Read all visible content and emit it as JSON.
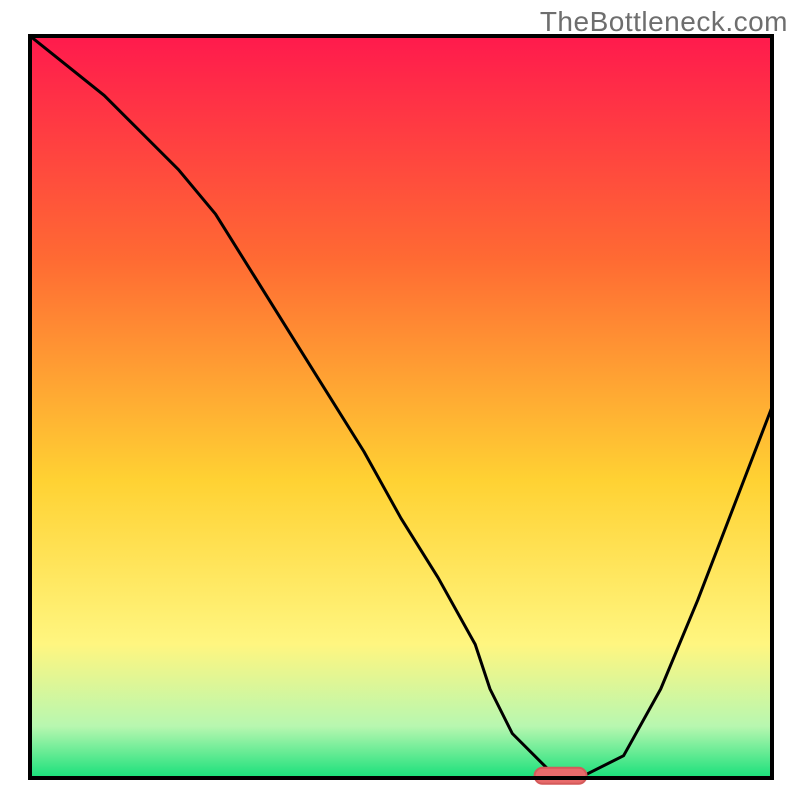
{
  "watermark": "TheBottleneck.com",
  "colors": {
    "gradient_top": "#ff1a4d",
    "gradient_mid1": "#ff6a33",
    "gradient_mid2": "#ffd233",
    "gradient_mid3": "#fff680",
    "gradient_bottom_soft": "#b8f7b0",
    "gradient_bottom": "#18e07a",
    "curve": "#000000",
    "frame": "#000000",
    "marker_fill": "#e86b6b",
    "marker_stroke": "#d45a5a"
  },
  "plot": {
    "inner_x": 30,
    "inner_y": 36,
    "inner_w": 742,
    "inner_h": 742
  },
  "chart_data": {
    "type": "line",
    "title": "",
    "xlabel": "",
    "ylabel": "",
    "xlim": [
      0,
      100
    ],
    "ylim": [
      0,
      100
    ],
    "grid": false,
    "legend": false,
    "annotations": [
      "TheBottleneck.com"
    ],
    "series": [
      {
        "name": "bottleneck-curve",
        "x": [
          0,
          5,
          10,
          15,
          20,
          25,
          30,
          35,
          40,
          45,
          50,
          55,
          60,
          62,
          65,
          70,
          72,
          75,
          80,
          85,
          90,
          95,
          100
        ],
        "y": [
          100,
          96,
          92,
          87,
          82,
          76,
          68,
          60,
          52,
          44,
          35,
          27,
          18,
          12,
          6,
          1,
          0.5,
          0.5,
          3,
          12,
          24,
          37,
          50
        ]
      }
    ],
    "marker": {
      "name": "optimal-range",
      "x_start": 68,
      "x_end": 75,
      "y": 0.3
    }
  }
}
